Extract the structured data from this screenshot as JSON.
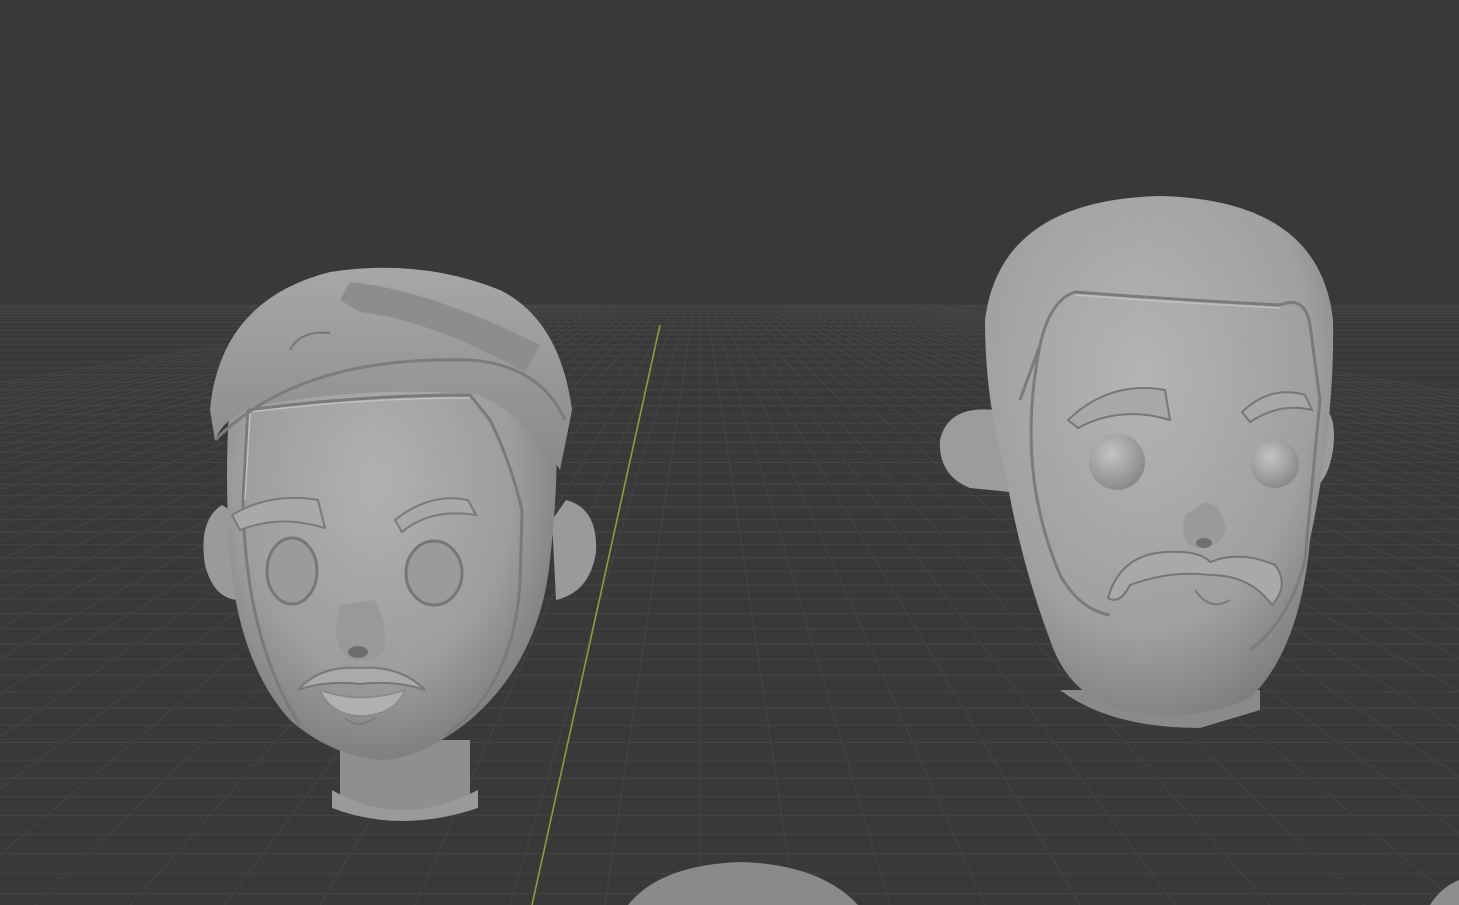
{
  "viewport": {
    "background_color": "#393939",
    "grid_color": "#454545",
    "y_axis_color": "#7ea43a",
    "mesh_color": "#a3a3a3"
  },
  "objects": [
    {
      "name": "head-with-cap"
    },
    {
      "name": "bald-head"
    },
    {
      "name": "partial-head-bottom"
    }
  ]
}
